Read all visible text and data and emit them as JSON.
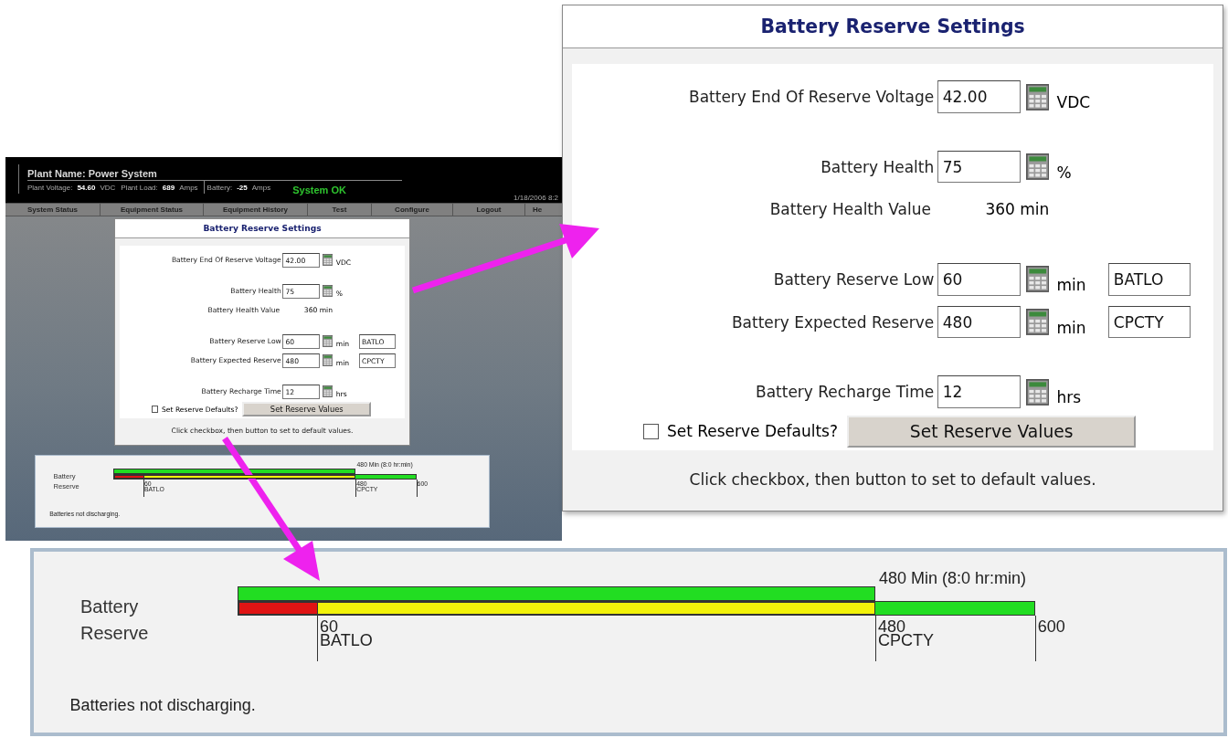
{
  "screen": {
    "header": {
      "plant_name": "Plant Name: Power System",
      "stats": [
        {
          "label": "Plant Voltage:",
          "value": "54.60",
          "unit": "VDC"
        },
        {
          "label": "Plant Load:",
          "value": "689",
          "unit": "Amps"
        },
        {
          "label": "Battery:",
          "value": "-25",
          "unit": "Amps"
        }
      ],
      "status": "System OK",
      "date": "1/18/2006 8:2"
    },
    "nav": [
      "System Status",
      "Equipment Status",
      "Equipment History",
      "Test",
      "Configure",
      "Logout",
      "He"
    ],
    "settings_panel": {
      "title": "Battery Reserve Settings",
      "groups": [
        [
          {
            "kind": "input",
            "label": "Battery End Of Reserve Voltage",
            "value": "42.00",
            "unit": "VDC"
          }
        ],
        [
          {
            "kind": "input",
            "label": "Battery Health",
            "value": "75",
            "unit": "%"
          },
          {
            "kind": "readout",
            "label": "Battery Health Value",
            "value": "360 min"
          }
        ],
        [
          {
            "kind": "input",
            "label": "Battery Reserve Low",
            "value": "60",
            "unit": "min",
            "tag": "BATLO"
          },
          {
            "kind": "input",
            "label": "Battery Expected Reserve",
            "value": "480",
            "unit": "min",
            "tag": "CPCTY"
          }
        ],
        [
          {
            "kind": "input",
            "label": "Battery Recharge Time",
            "value": "12",
            "unit": "hrs"
          }
        ]
      ],
      "checkbox": {
        "label": "Set Reserve Defaults?",
        "checked": false
      },
      "button": "Set Reserve Values",
      "note": "Click checkbox, then button to set to default values."
    },
    "reserve_panel": {
      "label": "Battery Reserve",
      "top_bar": {
        "level": 0.8,
        "caption": "480 Min (8:0 hr:min)"
      },
      "segments": [
        {
          "color": "#e01414",
          "level": 0.1
        },
        {
          "color": "#f2f20a",
          "level": 0.8
        },
        {
          "color": "#22dd22"
        }
      ],
      "ticks": [
        {
          "label": "60",
          "tag": "BATLO"
        },
        {
          "label": "480",
          "tag": "CPCTY"
        },
        {
          "label": "600"
        }
      ],
      "status": "Batteries not discharging."
    }
  },
  "settings_callout": {
    "title": "Battery Reserve Settings",
    "groups": [
      [
        {
          "kind": "input",
          "label": "Battery End Of Reserve Voltage",
          "value": "42.00",
          "unit": "VDC"
        }
      ],
      [
        {
          "kind": "input",
          "label": "Battery Health",
          "value": "75",
          "unit": "%"
        },
        {
          "kind": "readout",
          "label": "Battery Health Value",
          "value": "360 min"
        }
      ],
      [
        {
          "kind": "input",
          "label": "Battery Reserve Low",
          "value": "60",
          "unit": "min",
          "tag": "BATLO"
        },
        {
          "kind": "input",
          "label": "Battery Expected Reserve",
          "value": "480",
          "unit": "min",
          "tag": "CPCTY"
        }
      ],
      [
        {
          "kind": "input",
          "label": "Battery Recharge Time",
          "value": "12",
          "unit": "hrs"
        }
      ]
    ],
    "checkbox": {
      "label": "Set Reserve Defaults?",
      "checked": false
    },
    "button": "Set Reserve Values",
    "note": "Click checkbox, then button to set to default values."
  },
  "reserve_callout": {
    "label": "Battery Reserve",
    "top_bar": {
      "level": 0.8,
      "caption": "480 Min (8:0 hr:min)"
    },
    "segments": [
      {
        "color": "#e01414",
        "level": 0.1
      },
      {
        "color": "#f2f20a",
        "level": 0.8
      },
      {
        "color": "#22dd22"
      }
    ],
    "ticks": [
      {
        "label": "60",
        "tag": "BATLO"
      },
      {
        "label": "480",
        "tag": "CPCTY"
      },
      {
        "label": "600"
      }
    ],
    "status": "Batteries not discharging."
  }
}
